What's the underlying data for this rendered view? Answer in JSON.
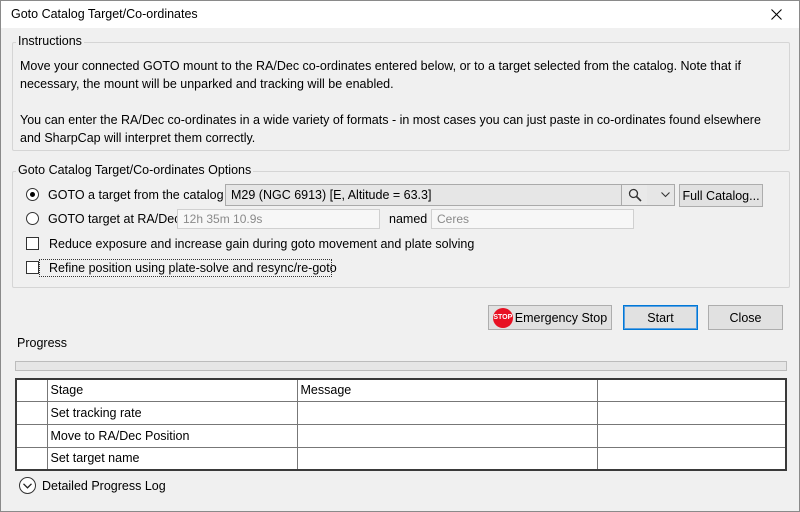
{
  "window": {
    "title": "Goto Catalog Target/Co-ordinates",
    "close_icon": "close-icon"
  },
  "instructions": {
    "legend": "Instructions",
    "paragraph1": "Move your connected GOTO mount to the RA/Dec co-ordinates entered below, or to a target selected from the catalog. Note that if necessary, the mount will be unparked and tracking will be enabled.",
    "paragraph2": "You can enter the RA/Dec co-ordinates in a wide variety of formats - in most cases you can just paste in co-ordinates found elsewhere and SharpCap will interpret them correctly."
  },
  "options": {
    "legend": "Goto Catalog Target/Co-ordinates Options",
    "catalog_radio_label": "GOTO a target from the catalog",
    "catalog_selected": "M29 (NGC 6913) [E, Altitude = 63.3]",
    "full_catalog_button": "Full Catalog...",
    "radec_radio_label": "GOTO target at RA/Dec",
    "radec_placeholder": "12h 35m 10.9s",
    "named_label": "named",
    "name_placeholder": "Ceres",
    "reduce_exposure_label": "Reduce exposure and increase gain during goto movement and plate solving",
    "refine_label": "Refine position using plate-solve and resync/re-goto",
    "selected_mode": "catalog"
  },
  "buttons": {
    "emergency_stop": "Emergency Stop",
    "stop_badge": "STOP",
    "start": "Start",
    "close": "Close"
  },
  "progress": {
    "legend": "Progress",
    "value": 0,
    "columns": [
      "",
      "Stage",
      "Message",
      ""
    ],
    "rows": [
      {
        "stage": "Set tracking rate",
        "message": ""
      },
      {
        "stage": "Move to RA/Dec Position",
        "message": ""
      },
      {
        "stage": "Set target name",
        "message": ""
      }
    ],
    "detailed_log_label": "Detailed Progress Log"
  },
  "colors": {
    "accent": "#0078d7",
    "stop_red": "#e81123"
  }
}
